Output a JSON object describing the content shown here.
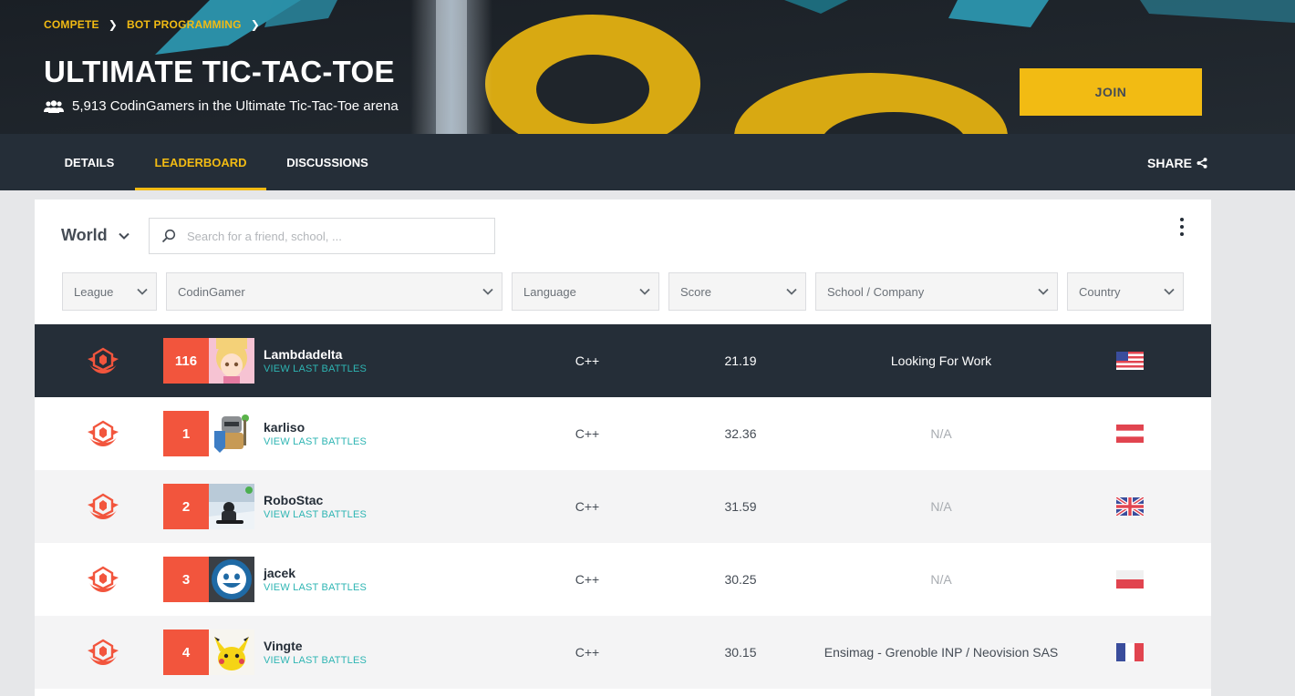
{
  "breadcrumb": {
    "items": [
      "COMPETE",
      "BOT PROGRAMMING"
    ]
  },
  "hero": {
    "title": "ULTIMATE TIC-TAC-TOE",
    "subtitle": "5,913 CodinGamers in the Ultimate Tic-Tac-Toe arena",
    "subtitle_icon": "users-icon",
    "join_label": "JOIN"
  },
  "tabs": [
    {
      "label": "DETAILS",
      "active": false
    },
    {
      "label": "LEADERBOARD",
      "active": true
    },
    {
      "label": "DISCUSSIONS",
      "active": false
    }
  ],
  "share": {
    "label": "SHARE",
    "icon": "share-icon"
  },
  "leaderboard": {
    "scope": "World",
    "search_placeholder": "Search for a friend, school, ...",
    "filters": [
      "League",
      "CodinGamer",
      "Language",
      "Score",
      "School / Company",
      "Country"
    ],
    "rows": [
      {
        "rank": "116",
        "name": "Lambdadelta",
        "battles_label": "VIEW LAST BATTLES",
        "language": "C++",
        "score": "21.19",
        "school": "Looking For Work",
        "country_flag": "us-flag",
        "highlight": true
      },
      {
        "rank": "1",
        "name": "karliso",
        "battles_label": "VIEW LAST BATTLES",
        "language": "C++",
        "score": "32.36",
        "school": "N/A",
        "country_flag": "at-flag"
      },
      {
        "rank": "2",
        "name": "RoboStac",
        "battles_label": "VIEW LAST BATTLES",
        "language": "C++",
        "score": "31.59",
        "school": "N/A",
        "country_flag": "gb-flag"
      },
      {
        "rank": "3",
        "name": "jacek",
        "battles_label": "VIEW LAST BATTLES",
        "language": "C++",
        "score": "30.25",
        "school": "N/A",
        "country_flag": "pl-flag"
      },
      {
        "rank": "4",
        "name": "Vingte",
        "battles_label": "VIEW LAST BATTLES",
        "language": "C++",
        "score": "30.15",
        "school": "Ensimag - Grenoble INP / Neovision SAS",
        "country_flag": "fr-flag"
      }
    ]
  },
  "colors": {
    "accent": "#f2bb13",
    "rank_badge": "#f2553d",
    "link": "#2eb5b3",
    "dark": "#252e38"
  }
}
